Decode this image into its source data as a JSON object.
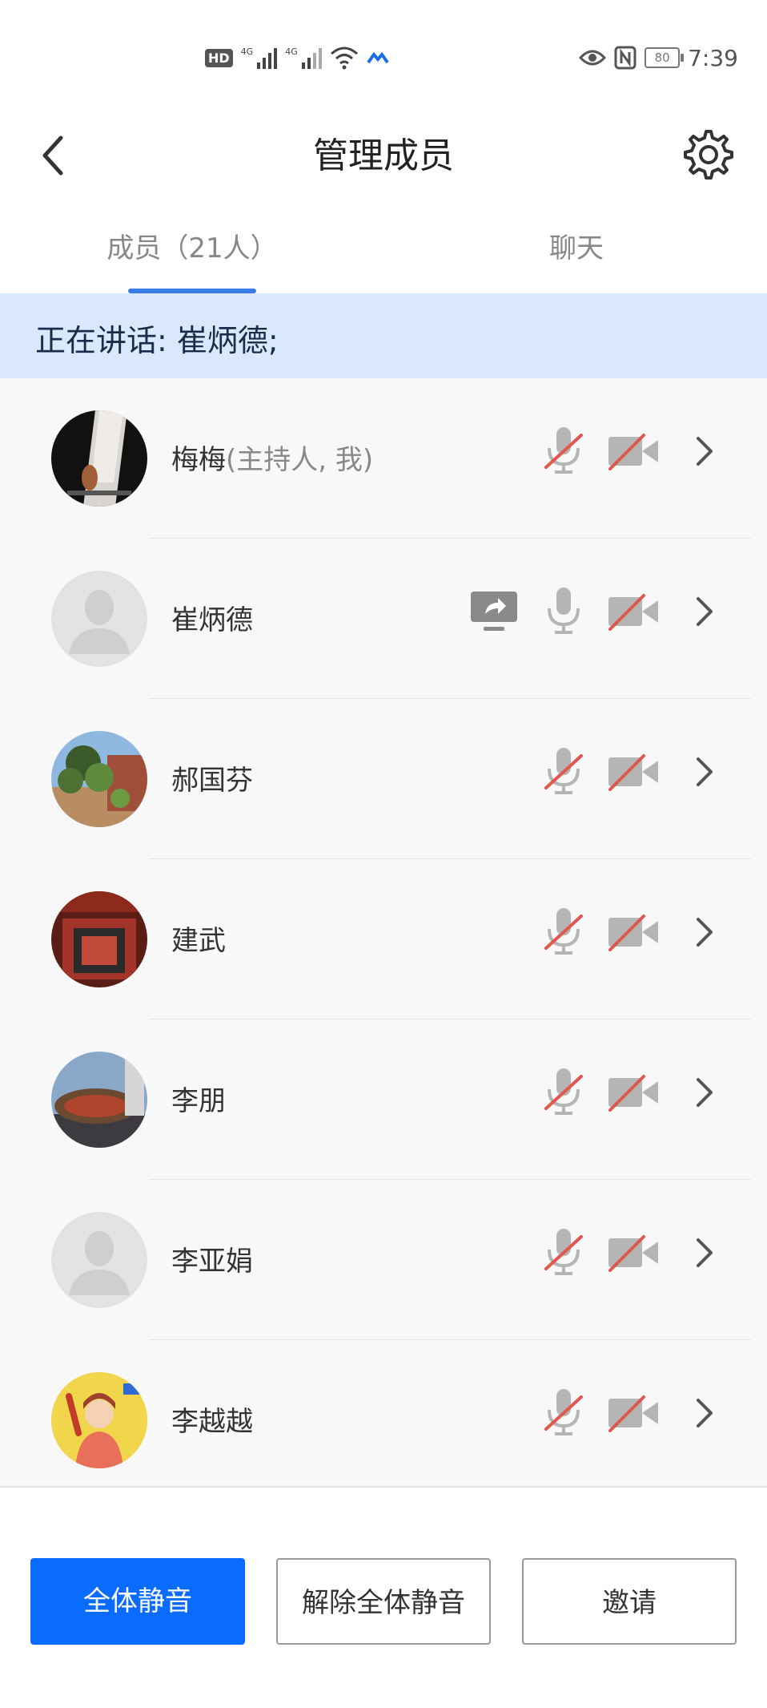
{
  "status_bar": {
    "hd_label": "HD",
    "network_1": "4G",
    "network_2": "4G",
    "battery": "80",
    "time": "7:39"
  },
  "header": {
    "title": "管理成员"
  },
  "tabs": [
    {
      "label": "成员（21人）",
      "active": true
    },
    {
      "label": "聊天",
      "active": false
    }
  ],
  "speaking_banner": "正在讲话: 崔炳德;",
  "members": [
    {
      "name": "梅梅",
      "role": "(主持人, 我)",
      "avatar": "photo-dark",
      "screen_share": false,
      "mic": "muted",
      "camera": "off"
    },
    {
      "name": "崔炳德",
      "role": "",
      "avatar": "default",
      "screen_share": true,
      "mic": "on",
      "camera": "off"
    },
    {
      "name": "郝国芬",
      "role": "",
      "avatar": "photo-plant",
      "screen_share": false,
      "mic": "muted",
      "camera": "off"
    },
    {
      "name": "建武",
      "role": "",
      "avatar": "photo-sign",
      "screen_share": false,
      "mic": "muted",
      "camera": "off"
    },
    {
      "name": "李朋",
      "role": "",
      "avatar": "photo-stadium",
      "screen_share": false,
      "mic": "muted",
      "camera": "off"
    },
    {
      "name": "李亚娟",
      "role": "",
      "avatar": "default",
      "screen_share": false,
      "mic": "muted",
      "camera": "off"
    },
    {
      "name": "李越越",
      "role": "",
      "avatar": "photo-cartoon",
      "screen_share": false,
      "mic": "muted",
      "camera": "off"
    }
  ],
  "buttons": {
    "mute_all": "全体静音",
    "unmute_all": "解除全体静音",
    "invite": "邀请"
  },
  "colors": {
    "primary": "#0a6cff",
    "tab_underline": "#3a7be6",
    "banner_bg": "#d9e9fb",
    "muted_slash": "#e0574f"
  }
}
